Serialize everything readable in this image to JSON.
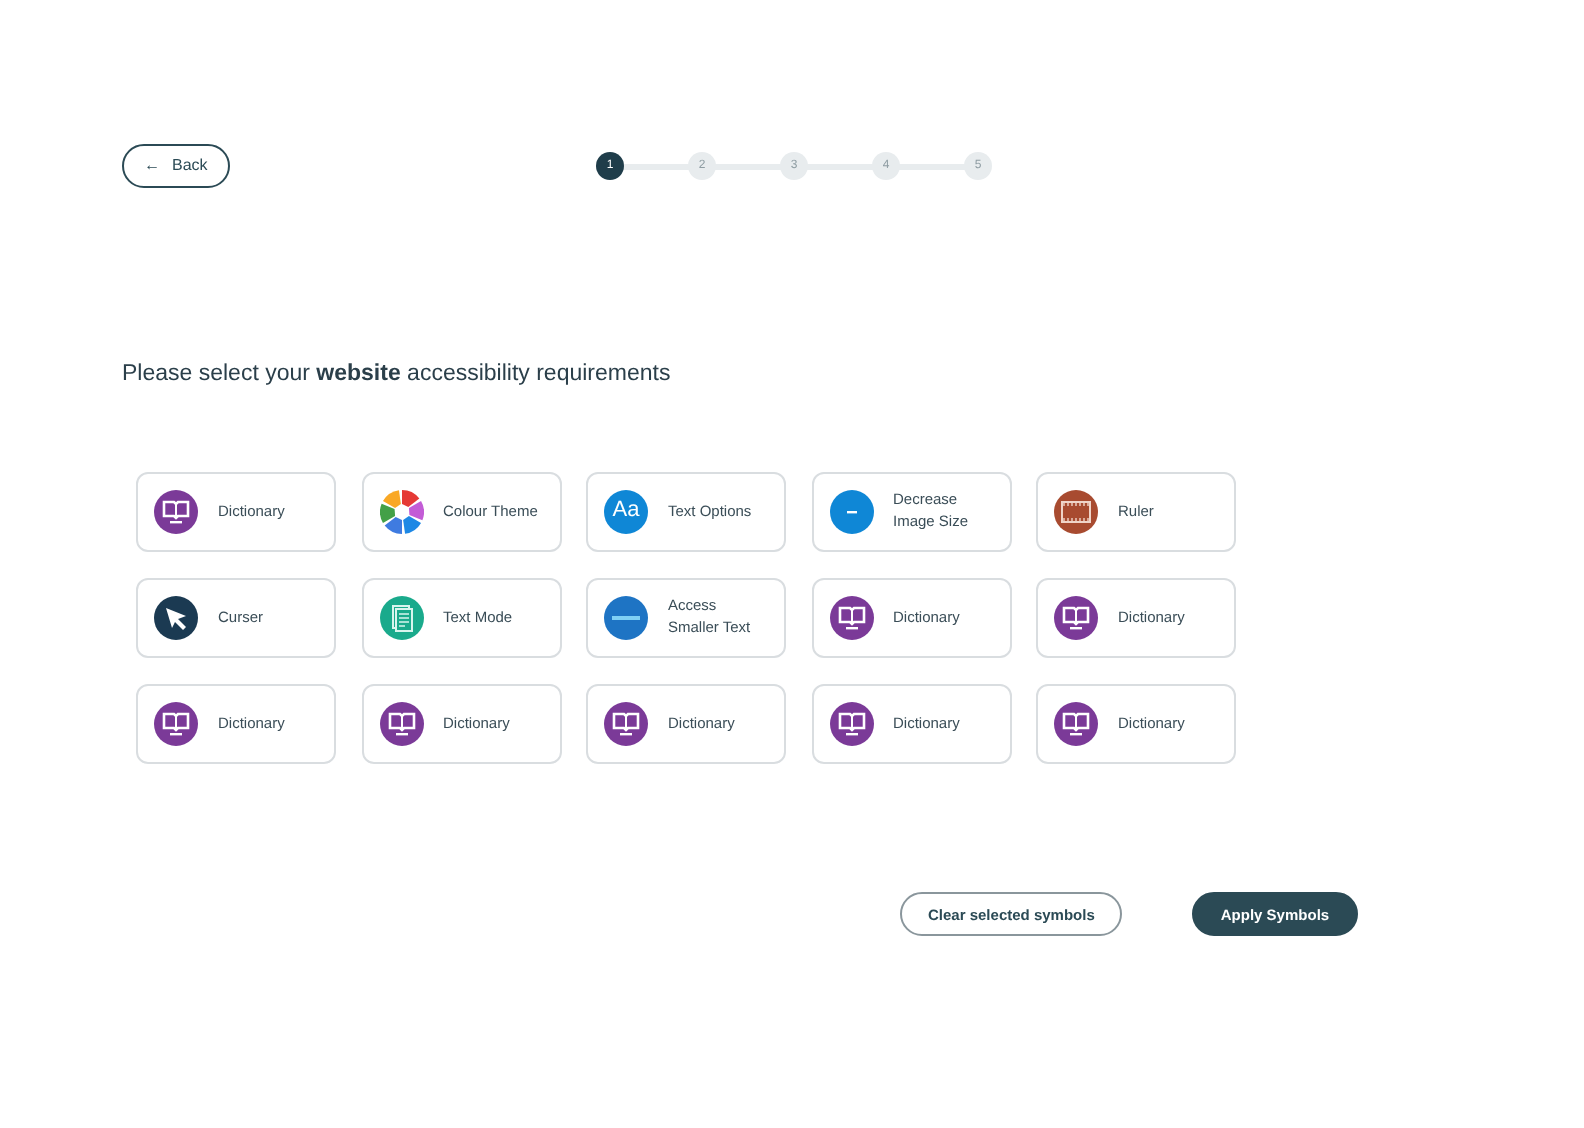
{
  "back_button": {
    "label": "Back",
    "icon": "←"
  },
  "steps": [
    {
      "label": "1",
      "selected": true
    },
    {
      "label": "2",
      "selected": false
    },
    {
      "label": "3",
      "selected": false
    },
    {
      "label": "4",
      "selected": false
    },
    {
      "label": "5",
      "selected": false
    }
  ],
  "heading": "Please select your **website** accessibility requirements",
  "options": [
    {
      "kind": "dictionary",
      "label": "Dictionary"
    },
    {
      "kind": "colour",
      "label": "Colour Theme"
    },
    {
      "kind": "text",
      "label": "Text Options",
      "icon_text": "Aa"
    },
    {
      "kind": "decrease",
      "label": "Decrease Image Size"
    },
    {
      "kind": "ruler",
      "label": "Ruler"
    },
    {
      "kind": "cursor",
      "label": "Curser"
    },
    {
      "kind": "textmode",
      "label": "Text Mode"
    },
    {
      "kind": "smaller",
      "label": "Access Smaller Text"
    },
    {
      "kind": "dictionary",
      "label": "Dictionary"
    },
    {
      "kind": "dictionary",
      "label": "Dictionary"
    },
    {
      "kind": "dictionary",
      "label": "Dictionary"
    },
    {
      "kind": "dictionary",
      "label": "Dictionary"
    },
    {
      "kind": "dictionary",
      "label": "Dictionary"
    },
    {
      "kind": "dictionary",
      "label": "Dictionary"
    },
    {
      "kind": "dictionary",
      "label": "Dictionary"
    }
  ],
  "actions": [
    {
      "kind": "secondary",
      "label": "Clear selected symbols"
    },
    {
      "kind": "primary",
      "label": "Apply Symbols"
    }
  ]
}
